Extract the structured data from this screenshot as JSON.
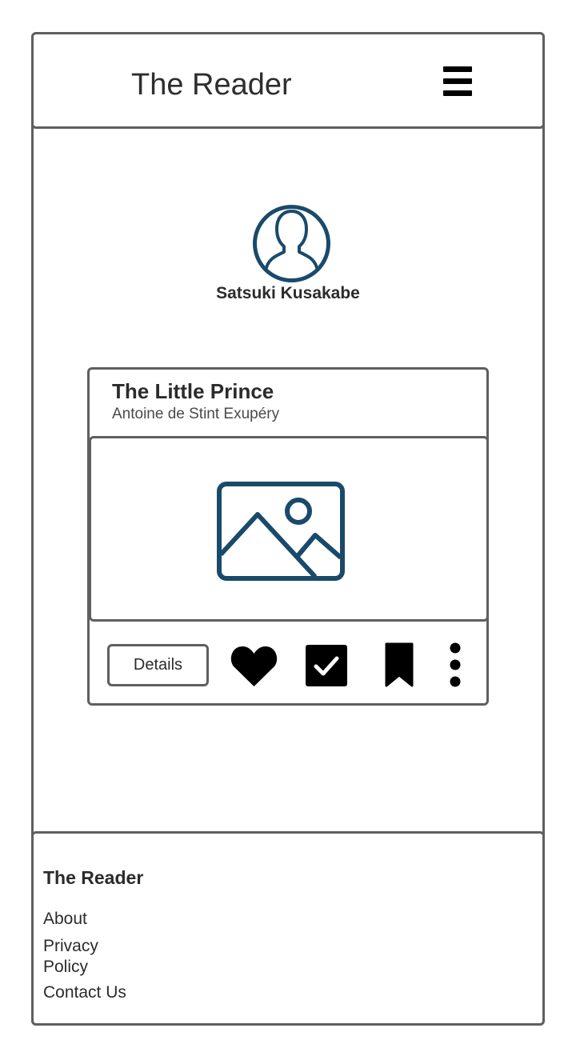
{
  "header": {
    "title": "The Reader",
    "menu_icon": "hamburger-menu-icon"
  },
  "profile": {
    "avatar_icon": "user-avatar-icon",
    "name": "Satsuki Kusakabe"
  },
  "book_card": {
    "title": "The Little Prince",
    "author": "Antoine de Stint Exupéry",
    "image_icon": "image-placeholder-icon",
    "actions": {
      "details_label": "Details",
      "like_icon": "heart-icon",
      "read_icon": "checkbox-checked-icon",
      "save_icon": "bookmark-icon",
      "more_icon": "vertical-ellipsis-icon"
    }
  },
  "footer": {
    "title": "The Reader",
    "links": [
      {
        "line1": "About"
      },
      {
        "line1": "Privacy",
        "line2": "Policy"
      },
      {
        "line1": "Contact Us"
      }
    ]
  },
  "colors": {
    "border": "#5f5f5f",
    "icon_accent": "#1a4a6b",
    "text": "#2b2b2b"
  }
}
